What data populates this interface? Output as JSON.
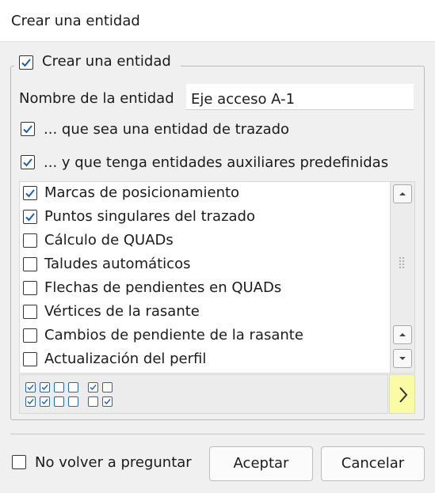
{
  "window": {
    "title": "Crear una entidad"
  },
  "group": {
    "checked": true,
    "label": "Crear una entidad"
  },
  "name_field": {
    "label": "Nombre de la entidad",
    "value": "Eje acceso A-1"
  },
  "options": [
    {
      "checked": true,
      "label": "... que sea una entidad de trazado"
    },
    {
      "checked": true,
      "label": "... y que tenga entidades auxiliares predefinidas"
    }
  ],
  "aux_list": {
    "items": [
      {
        "checked": true,
        "label": "Marcas de posicionamiento"
      },
      {
        "checked": true,
        "label": "Puntos singulares del trazado"
      },
      {
        "checked": false,
        "label": "Cálculo de QUADs"
      },
      {
        "checked": false,
        "label": "Taludes automáticos"
      },
      {
        "checked": false,
        "label": "Flechas de pendientes en QUADs"
      },
      {
        "checked": false,
        "label": "Vértices de la rasante"
      },
      {
        "checked": false,
        "label": "Cambios de pendiente de la rasante"
      },
      {
        "checked": false,
        "label": "Actualización del perfil"
      }
    ]
  },
  "preset_icons": [
    [
      true,
      true,
      false,
      false,
      true,
      false
    ],
    [
      true,
      true,
      false,
      false,
      false,
      true
    ]
  ],
  "footer": {
    "dont_ask_checked": false,
    "dont_ask_label": "No volver a preguntar",
    "accept_label": "Aceptar",
    "cancel_label": "Cancelar"
  },
  "colors": {
    "check": "#1a5fb4",
    "icon_blue": "#2a66b3",
    "next_bg": "#fbfba6"
  }
}
